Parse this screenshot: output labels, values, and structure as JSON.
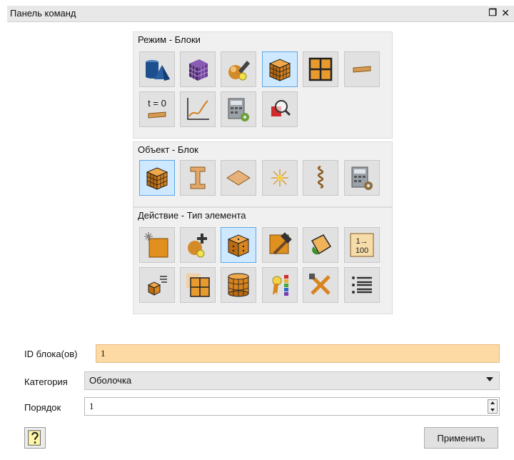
{
  "panel": {
    "title": "Панель команд"
  },
  "groups": {
    "mode": {
      "label": "Режим - Блоки"
    },
    "object": {
      "label": "Объект - Блок"
    },
    "action": {
      "label": "Действие - Тип элемента"
    }
  },
  "mode_icons": [
    "geometry-primitives-icon",
    "mesh-cube-icon",
    "tools-sphere-icon",
    "block-cube-icon",
    "grid-layout-icon",
    "beam-section-icon",
    "time-zero-icon",
    "curve-graph-icon",
    "calculator-gear-icon",
    "search-red-square-icon"
  ],
  "mode_tile_text": {
    "t0": "t = 0"
  },
  "object_icons": [
    "block-cube-icon",
    "i-beam-icon",
    "surface-diamond-icon",
    "node-star-icon",
    "spring-coil-icon",
    "calculator-gear-icon"
  ],
  "action_icons": [
    "new-element-icon",
    "add-element-icon",
    "hex-element-icon",
    "hammer-icon",
    "paint-bucket-icon",
    "renumber-icon",
    "block-list-icon",
    "block-split-icon",
    "cylinder-icon",
    "ribbon-legend-icon",
    "crossed-tools-icon",
    "list-lines-icon"
  ],
  "action_tile_text": {
    "renumber_top": "1→",
    "renumber_bottom": "100"
  },
  "form": {
    "block_id_label": "ID блока(ов)",
    "block_id_value": "1",
    "category_label": "Категория",
    "category_value": "Оболочка",
    "order_label": "Порядок",
    "order_value": "1"
  },
  "buttons": {
    "apply_label": "Применить"
  },
  "colors": {
    "selected_tile": "#cde8ff",
    "block_id_field": "#fdd9a4"
  }
}
